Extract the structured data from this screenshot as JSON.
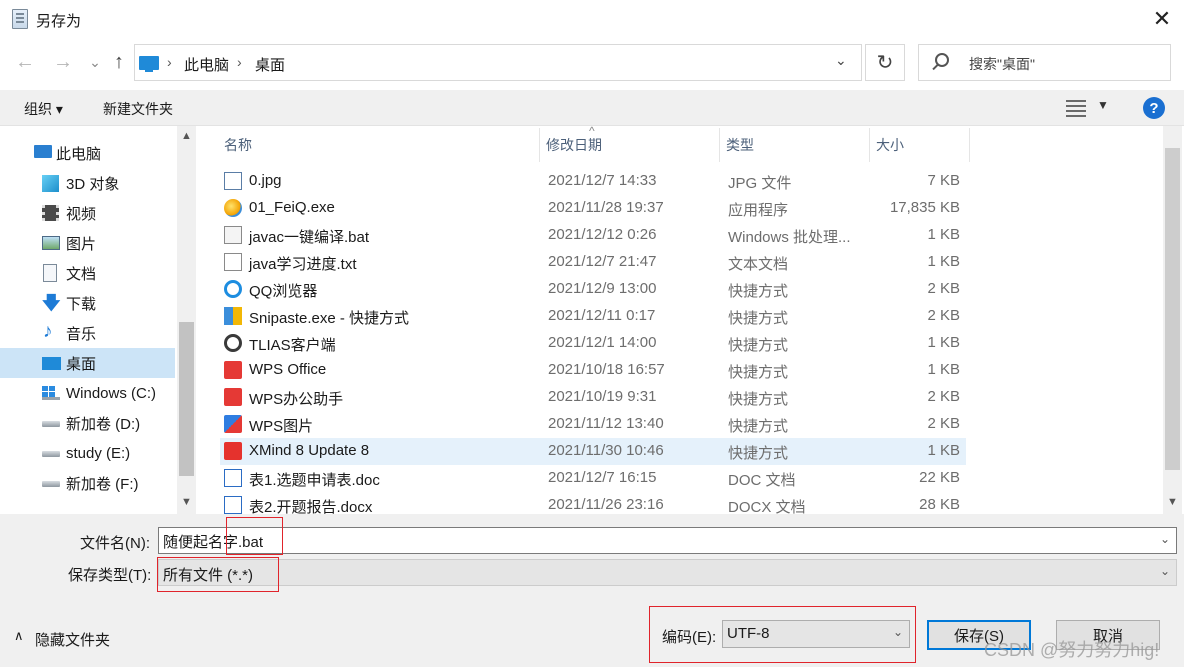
{
  "window": {
    "title": "另存为",
    "close_glyph": "✕"
  },
  "address": {
    "back_glyph": "←",
    "forward_glyph": "→",
    "history_glyph": "⌄",
    "up_glyph": "↑",
    "separator": "›",
    "crumbs": [
      "此电脑",
      "桌面"
    ],
    "refresh_glyph": "↻",
    "search_placeholder": "搜索\"桌面\""
  },
  "toolbar": {
    "organize_label": "组织 ▾",
    "new_folder_label": "新建文件夹",
    "help_glyph": "?"
  },
  "nav": {
    "items": [
      {
        "label": "此电脑",
        "icon": "computer-icon"
      },
      {
        "label": "3D 对象",
        "icon": "cube-3d-icon"
      },
      {
        "label": "视频",
        "icon": "video-icon"
      },
      {
        "label": "图片",
        "icon": "picture-icon"
      },
      {
        "label": "文档",
        "icon": "document-icon"
      },
      {
        "label": "下载",
        "icon": "download-icon"
      },
      {
        "label": "音乐",
        "icon": "music-icon"
      },
      {
        "label": "桌面",
        "icon": "desktop-icon",
        "selected": true
      },
      {
        "label": "Windows (C:)",
        "icon": "windows-drive-icon"
      },
      {
        "label": "新加卷 (D:)",
        "icon": "drive-icon"
      },
      {
        "label": "study (E:)",
        "icon": "drive-icon"
      },
      {
        "label": "新加卷 (F:)",
        "icon": "drive-icon"
      }
    ]
  },
  "list": {
    "columns": {
      "name": "名称",
      "date": "修改日期",
      "type": "类型",
      "size": "大小"
    },
    "rows": [
      {
        "name": "0.jpg",
        "date": "2021/12/7 14:33",
        "type": "JPG 文件",
        "size": "7 KB",
        "icon": "jpg-file-icon"
      },
      {
        "name": "01_FeiQ.exe",
        "date": "2021/11/28 19:37",
        "type": "应用程序",
        "size": "17,835 KB",
        "icon": "feiq-app-icon"
      },
      {
        "name": "javac一键编译.bat",
        "date": "2021/12/12 0:26",
        "type": "Windows 批处理...",
        "size": "1 KB",
        "icon": "bat-file-icon"
      },
      {
        "name": "java学习进度.txt",
        "date": "2021/12/7 21:47",
        "type": "文本文档",
        "size": "1 KB",
        "icon": "txt-file-icon"
      },
      {
        "name": "QQ浏览器",
        "date": "2021/12/9 13:00",
        "type": "快捷方式",
        "size": "2 KB",
        "icon": "qq-browser-icon"
      },
      {
        "name": "Snipaste.exe - 快捷方式",
        "date": "2021/12/11 0:17",
        "type": "快捷方式",
        "size": "2 KB",
        "icon": "snipaste-icon"
      },
      {
        "name": "TLIAS客户端",
        "date": "2021/12/1 14:00",
        "type": "快捷方式",
        "size": "1 KB",
        "icon": "tlias-icon"
      },
      {
        "name": "WPS Office",
        "date": "2021/10/18 16:57",
        "type": "快捷方式",
        "size": "1 KB",
        "icon": "wps-icon"
      },
      {
        "name": "WPS办公助手",
        "date": "2021/10/19 9:31",
        "type": "快捷方式",
        "size": "2 KB",
        "icon": "wps-icon"
      },
      {
        "name": "WPS图片",
        "date": "2021/11/12 13:40",
        "type": "快捷方式",
        "size": "2 KB",
        "icon": "wps-picture-icon"
      },
      {
        "name": "XMind 8 Update 8",
        "date": "2021/11/30 10:46",
        "type": "快捷方式",
        "size": "1 KB",
        "icon": "xmind-icon",
        "selected": true
      },
      {
        "name": "表1.选题申请表.doc",
        "date": "2021/12/7 16:15",
        "type": "DOC 文档",
        "size": "22 KB",
        "icon": "doc-file-icon"
      },
      {
        "name": "表2.开题报告.docx",
        "date": "2021/11/26 23:16",
        "type": "DOCX 文档",
        "size": "28 KB",
        "icon": "docx-file-icon"
      }
    ]
  },
  "form": {
    "filename_label": "文件名(N):",
    "filename_value": "随便起名字.bat",
    "filetype_label": "保存类型(T):",
    "filetype_value": "所有文件 (*.*)",
    "hide_folders_label": "隐藏文件夹",
    "encoding_label": "编码(E):",
    "encoding_value": "UTF-8",
    "save_label": "保存(S)",
    "cancel_label": "取消"
  },
  "watermark": "CSDN @努力努力hig!",
  "colors": {
    "accent": "#0078d7",
    "selection": "#cce4f7",
    "annotation_red": "#e0242b"
  }
}
